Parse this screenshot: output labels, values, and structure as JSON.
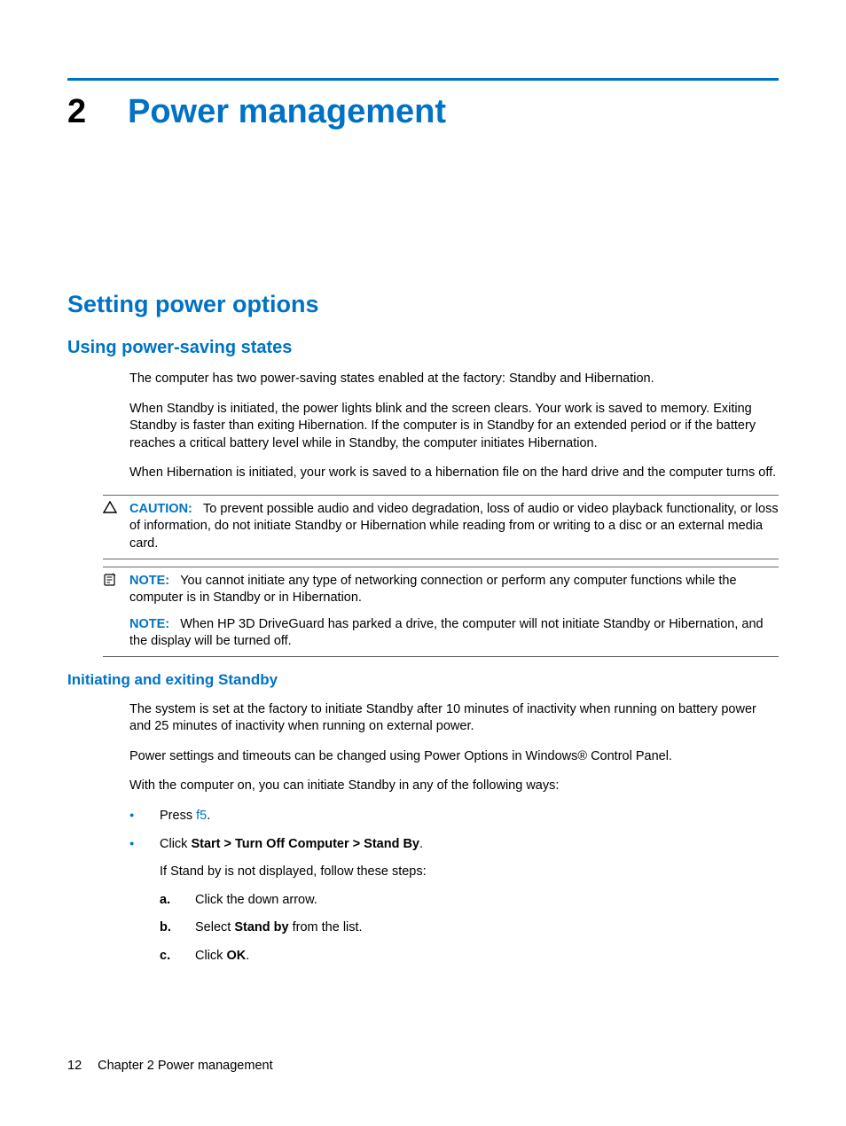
{
  "chapter": {
    "number": "2",
    "title": "Power management"
  },
  "h1": "Setting power options",
  "h2": "Using power-saving states",
  "h3": "Initiating and exiting Standby",
  "p1": "The computer has two power-saving states enabled at the factory: Standby and Hibernation.",
  "p2": "When Standby is initiated, the power lights blink and the screen clears. Your work is saved to memory. Exiting Standby is faster than exiting Hibernation. If the computer is in Standby for an extended period or if the battery reaches a critical battery level while in Standby, the computer initiates Hibernation.",
  "p3": "When Hibernation is initiated, your work is saved to a hibernation file on the hard drive and the computer turns off.",
  "caution": {
    "label": "CAUTION:",
    "text": "To prevent possible audio and video degradation, loss of audio or video playback functionality, or loss of information, do not initiate Standby or Hibernation while reading from or writing to a disc or an external media card."
  },
  "notes": {
    "label": "NOTE:",
    "n1": "You cannot initiate any type of networking connection or perform any computer functions while the computer is in Standby or in Hibernation.",
    "n2": "When HP 3D DriveGuard has parked a drive, the computer will not initiate Standby or Hibernation, and the display will be turned off."
  },
  "p4": "The system is set at the factory to initiate Standby after 10 minutes of inactivity when running on battery power and 25 minutes of inactivity when running on external power.",
  "p5": "Power settings and timeouts can be changed using Power Options in Windows® Control Panel.",
  "p6": "With the computer on, you can initiate Standby in any of the following ways:",
  "bullets": {
    "b1_prefix": "Press ",
    "b1_key": "f5",
    "b1_suffix": ".",
    "b2_prefix": "Click ",
    "b2_bold": "Start > Turn Off Computer > Stand By",
    "b2_suffix": ".",
    "b2_sub": "If Stand by is not displayed, follow these steps:"
  },
  "steps": {
    "a": {
      "label": "a.",
      "text": "Click the down arrow."
    },
    "b": {
      "label": "b.",
      "prefix": "Select ",
      "bold": "Stand by",
      "suffix": " from the list."
    },
    "c": {
      "label": "c.",
      "prefix": "Click ",
      "bold": "OK",
      "suffix": "."
    }
  },
  "footer": {
    "page": "12",
    "chapter_label": "Chapter 2   Power management"
  }
}
